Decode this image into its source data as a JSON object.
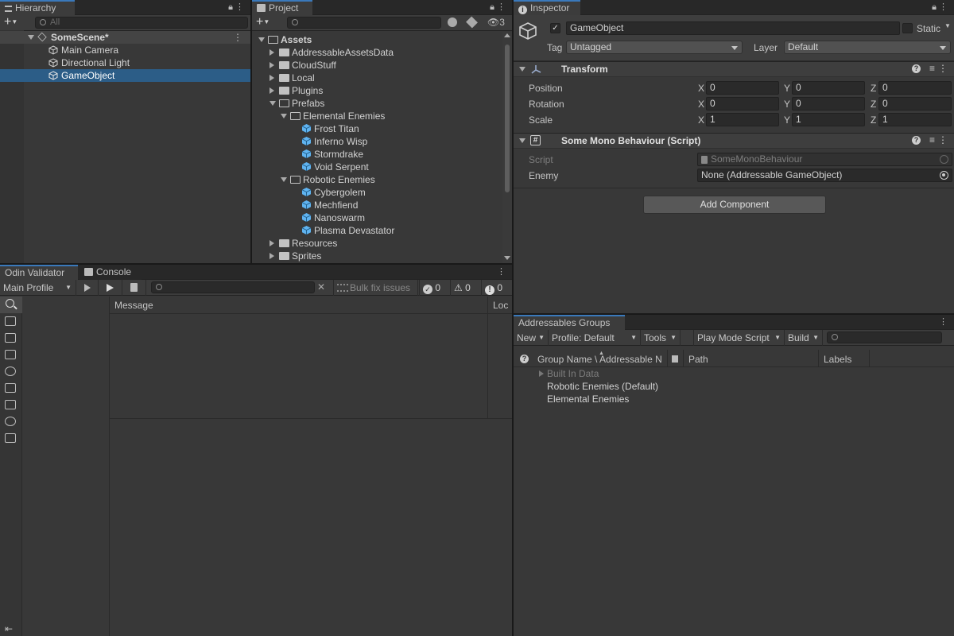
{
  "hierarchy": {
    "tab_label": "Hierarchy",
    "search_placeholder": "All",
    "scene_name": "SomeScene*",
    "items": [
      {
        "label": "Main Camera"
      },
      {
        "label": "Directional Light"
      },
      {
        "label": "GameObject"
      }
    ]
  },
  "project": {
    "tab_label": "Project",
    "hidden_count": "3",
    "root": "Assets",
    "folders": [
      "AddressableAssetsData",
      "CloudStuff",
      "Local",
      "Plugins",
      "Prefabs",
      "Elemental Enemies",
      "Frost Titan",
      "Inferno Wisp",
      "Stormdrake",
      "Void Serpent",
      "Robotic Enemies",
      "Cybergolem",
      "Mechfiend",
      "Nanoswarm",
      "Plasma Devastator",
      "Resources",
      "Sprites"
    ]
  },
  "inspector": {
    "tab_label": "Inspector",
    "object_name": "GameObject",
    "static_label": "Static",
    "tag_label": "Tag",
    "tag_value": "Untagged",
    "layer_label": "Layer",
    "layer_value": "Default",
    "transform": {
      "title": "Transform",
      "rows": [
        {
          "label": "Position",
          "x": "0",
          "y": "0",
          "z": "0"
        },
        {
          "label": "Rotation",
          "x": "0",
          "y": "0",
          "z": "0"
        },
        {
          "label": "Scale",
          "x": "1",
          "y": "1",
          "z": "1"
        }
      ],
      "axis_x": "X",
      "axis_y": "Y",
      "axis_z": "Z"
    },
    "script_component": {
      "title": "Some Mono Behaviour (Script)",
      "script_label": "Script",
      "script_value": "SomeMonoBehaviour",
      "enemy_label": "Enemy",
      "enemy_value": "None (Addressable GameObject)"
    },
    "add_component": "Add Component"
  },
  "odin": {
    "tab_label": "Odin Validator",
    "console_tab_label": "Console",
    "profile": "Main Profile",
    "bulk_fix": "Bulk fix issues",
    "count_ok": "0",
    "count_warn": "0",
    "count_err": "0",
    "col_message": "Message",
    "col_loc": "Loc"
  },
  "addressables": {
    "tab_label": "Addressables Groups",
    "toolbar": {
      "new": "New",
      "profile": "Profile: Default",
      "tools": "Tools",
      "play_mode": "Play Mode Script",
      "build": "Build"
    },
    "columns": {
      "group_name": "Group Name \\ Addressable N",
      "path": "Path",
      "labels": "Labels"
    },
    "groups": [
      {
        "label": "Built In Data"
      },
      {
        "label": "Robotic Enemies (Default)"
      },
      {
        "label": "Elemental Enemies"
      }
    ]
  }
}
